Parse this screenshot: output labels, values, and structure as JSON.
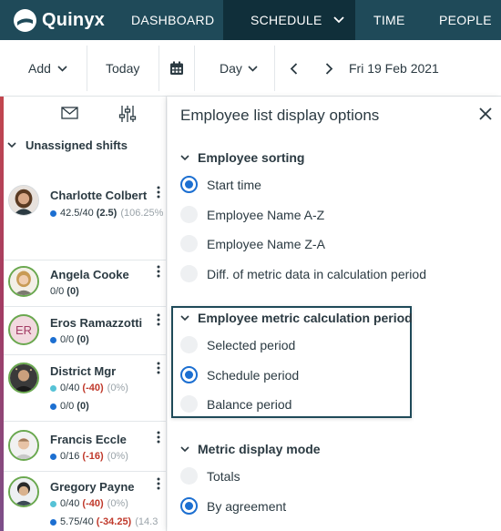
{
  "app": {
    "logo_text": "Quinyx"
  },
  "nav": {
    "items": [
      {
        "label": "DASHBOARD",
        "icon": null
      },
      {
        "label": "SCHEDULE",
        "icon": "chevron-down-icon",
        "active": true
      },
      {
        "label": "TIME"
      },
      {
        "label": "PEOPLE"
      }
    ]
  },
  "toolbar": {
    "add_label": "Add",
    "today_label": "Today",
    "view_label": "Day",
    "date": "Fri 19 Feb 2021"
  },
  "sidebar": {
    "unassigned_label": "Unassigned shifts",
    "employees": [
      {
        "name": "Charlotte Colbert",
        "metric_value": "42.5/40",
        "metric_diff": "(2.5)",
        "metric_pct": "(106.25%"
      },
      {
        "name": "Angela Cooke",
        "metric_value": "0/0",
        "metric_diff": "(0)"
      },
      {
        "name": "Eros Ramazzotti",
        "initials": "ER",
        "metric_value": "0/0",
        "metric_diff": "(0)"
      },
      {
        "name": "District Mgr",
        "metric1_value": "0/40",
        "metric1_diff": "(-40)",
        "metric1_pct": "(0%)",
        "metric2_value": "0/0",
        "metric2_diff": "(0)"
      },
      {
        "name": "Francis Eccle",
        "metric_value": "0/16",
        "metric_diff": "(-16)",
        "metric_pct": "(0%)"
      },
      {
        "name": "Gregory Payne",
        "metric1_value": "0/40",
        "metric1_diff": "(-40)",
        "metric1_pct": "(0%)",
        "metric2_value": "5.75/40",
        "metric2_diff": "(-34.25)",
        "metric2_pct": "(14.3"
      }
    ]
  },
  "panel": {
    "title": "Employee list display options",
    "sections": [
      {
        "title": "Employee sorting",
        "options": [
          "Start time",
          "Employee Name A-Z",
          "Employee Name Z-A",
          "Diff. of metric data in calculation period"
        ],
        "selected": "Start time"
      },
      {
        "title": "Employee metric calculation period",
        "options": [
          "Selected period",
          "Schedule period",
          "Balance period"
        ],
        "selected": "Schedule period"
      },
      {
        "title": "Metric display mode",
        "options": [
          "Totals",
          "By agreement"
        ],
        "selected": "By agreement"
      }
    ]
  },
  "colors": {
    "nav_bg": "#1f4a59",
    "nav_active_bg": "#102f3a",
    "accent": "#1c6fd1",
    "negative": "#c0392b"
  }
}
